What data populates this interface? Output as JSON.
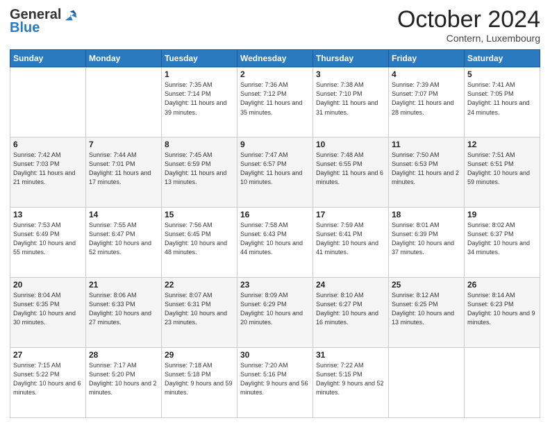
{
  "logo": {
    "general": "General",
    "blue": "Blue"
  },
  "header": {
    "month": "October 2024",
    "location": "Contern, Luxembourg"
  },
  "days_of_week": [
    "Sunday",
    "Monday",
    "Tuesday",
    "Wednesday",
    "Thursday",
    "Friday",
    "Saturday"
  ],
  "weeks": [
    [
      {
        "day": "",
        "info": ""
      },
      {
        "day": "",
        "info": ""
      },
      {
        "day": "1",
        "info": "Sunrise: 7:35 AM\nSunset: 7:14 PM\nDaylight: 11 hours and 39 minutes."
      },
      {
        "day": "2",
        "info": "Sunrise: 7:36 AM\nSunset: 7:12 PM\nDaylight: 11 hours and 35 minutes."
      },
      {
        "day": "3",
        "info": "Sunrise: 7:38 AM\nSunset: 7:10 PM\nDaylight: 11 hours and 31 minutes."
      },
      {
        "day": "4",
        "info": "Sunrise: 7:39 AM\nSunset: 7:07 PM\nDaylight: 11 hours and 28 minutes."
      },
      {
        "day": "5",
        "info": "Sunrise: 7:41 AM\nSunset: 7:05 PM\nDaylight: 11 hours and 24 minutes."
      }
    ],
    [
      {
        "day": "6",
        "info": "Sunrise: 7:42 AM\nSunset: 7:03 PM\nDaylight: 11 hours and 21 minutes."
      },
      {
        "day": "7",
        "info": "Sunrise: 7:44 AM\nSunset: 7:01 PM\nDaylight: 11 hours and 17 minutes."
      },
      {
        "day": "8",
        "info": "Sunrise: 7:45 AM\nSunset: 6:59 PM\nDaylight: 11 hours and 13 minutes."
      },
      {
        "day": "9",
        "info": "Sunrise: 7:47 AM\nSunset: 6:57 PM\nDaylight: 11 hours and 10 minutes."
      },
      {
        "day": "10",
        "info": "Sunrise: 7:48 AM\nSunset: 6:55 PM\nDaylight: 11 hours and 6 minutes."
      },
      {
        "day": "11",
        "info": "Sunrise: 7:50 AM\nSunset: 6:53 PM\nDaylight: 11 hours and 2 minutes."
      },
      {
        "day": "12",
        "info": "Sunrise: 7:51 AM\nSunset: 6:51 PM\nDaylight: 10 hours and 59 minutes."
      }
    ],
    [
      {
        "day": "13",
        "info": "Sunrise: 7:53 AM\nSunset: 6:49 PM\nDaylight: 10 hours and 55 minutes."
      },
      {
        "day": "14",
        "info": "Sunrise: 7:55 AM\nSunset: 6:47 PM\nDaylight: 10 hours and 52 minutes."
      },
      {
        "day": "15",
        "info": "Sunrise: 7:56 AM\nSunset: 6:45 PM\nDaylight: 10 hours and 48 minutes."
      },
      {
        "day": "16",
        "info": "Sunrise: 7:58 AM\nSunset: 6:43 PM\nDaylight: 10 hours and 44 minutes."
      },
      {
        "day": "17",
        "info": "Sunrise: 7:59 AM\nSunset: 6:41 PM\nDaylight: 10 hours and 41 minutes."
      },
      {
        "day": "18",
        "info": "Sunrise: 8:01 AM\nSunset: 6:39 PM\nDaylight: 10 hours and 37 minutes."
      },
      {
        "day": "19",
        "info": "Sunrise: 8:02 AM\nSunset: 6:37 PM\nDaylight: 10 hours and 34 minutes."
      }
    ],
    [
      {
        "day": "20",
        "info": "Sunrise: 8:04 AM\nSunset: 6:35 PM\nDaylight: 10 hours and 30 minutes."
      },
      {
        "day": "21",
        "info": "Sunrise: 8:06 AM\nSunset: 6:33 PM\nDaylight: 10 hours and 27 minutes."
      },
      {
        "day": "22",
        "info": "Sunrise: 8:07 AM\nSunset: 6:31 PM\nDaylight: 10 hours and 23 minutes."
      },
      {
        "day": "23",
        "info": "Sunrise: 8:09 AM\nSunset: 6:29 PM\nDaylight: 10 hours and 20 minutes."
      },
      {
        "day": "24",
        "info": "Sunrise: 8:10 AM\nSunset: 6:27 PM\nDaylight: 10 hours and 16 minutes."
      },
      {
        "day": "25",
        "info": "Sunrise: 8:12 AM\nSunset: 6:25 PM\nDaylight: 10 hours and 13 minutes."
      },
      {
        "day": "26",
        "info": "Sunrise: 8:14 AM\nSunset: 6:23 PM\nDaylight: 10 hours and 9 minutes."
      }
    ],
    [
      {
        "day": "27",
        "info": "Sunrise: 7:15 AM\nSunset: 5:22 PM\nDaylight: 10 hours and 6 minutes."
      },
      {
        "day": "28",
        "info": "Sunrise: 7:17 AM\nSunset: 5:20 PM\nDaylight: 10 hours and 2 minutes."
      },
      {
        "day": "29",
        "info": "Sunrise: 7:18 AM\nSunset: 5:18 PM\nDaylight: 9 hours and 59 minutes."
      },
      {
        "day": "30",
        "info": "Sunrise: 7:20 AM\nSunset: 5:16 PM\nDaylight: 9 hours and 56 minutes."
      },
      {
        "day": "31",
        "info": "Sunrise: 7:22 AM\nSunset: 5:15 PM\nDaylight: 9 hours and 52 minutes."
      },
      {
        "day": "",
        "info": ""
      },
      {
        "day": "",
        "info": ""
      }
    ]
  ]
}
